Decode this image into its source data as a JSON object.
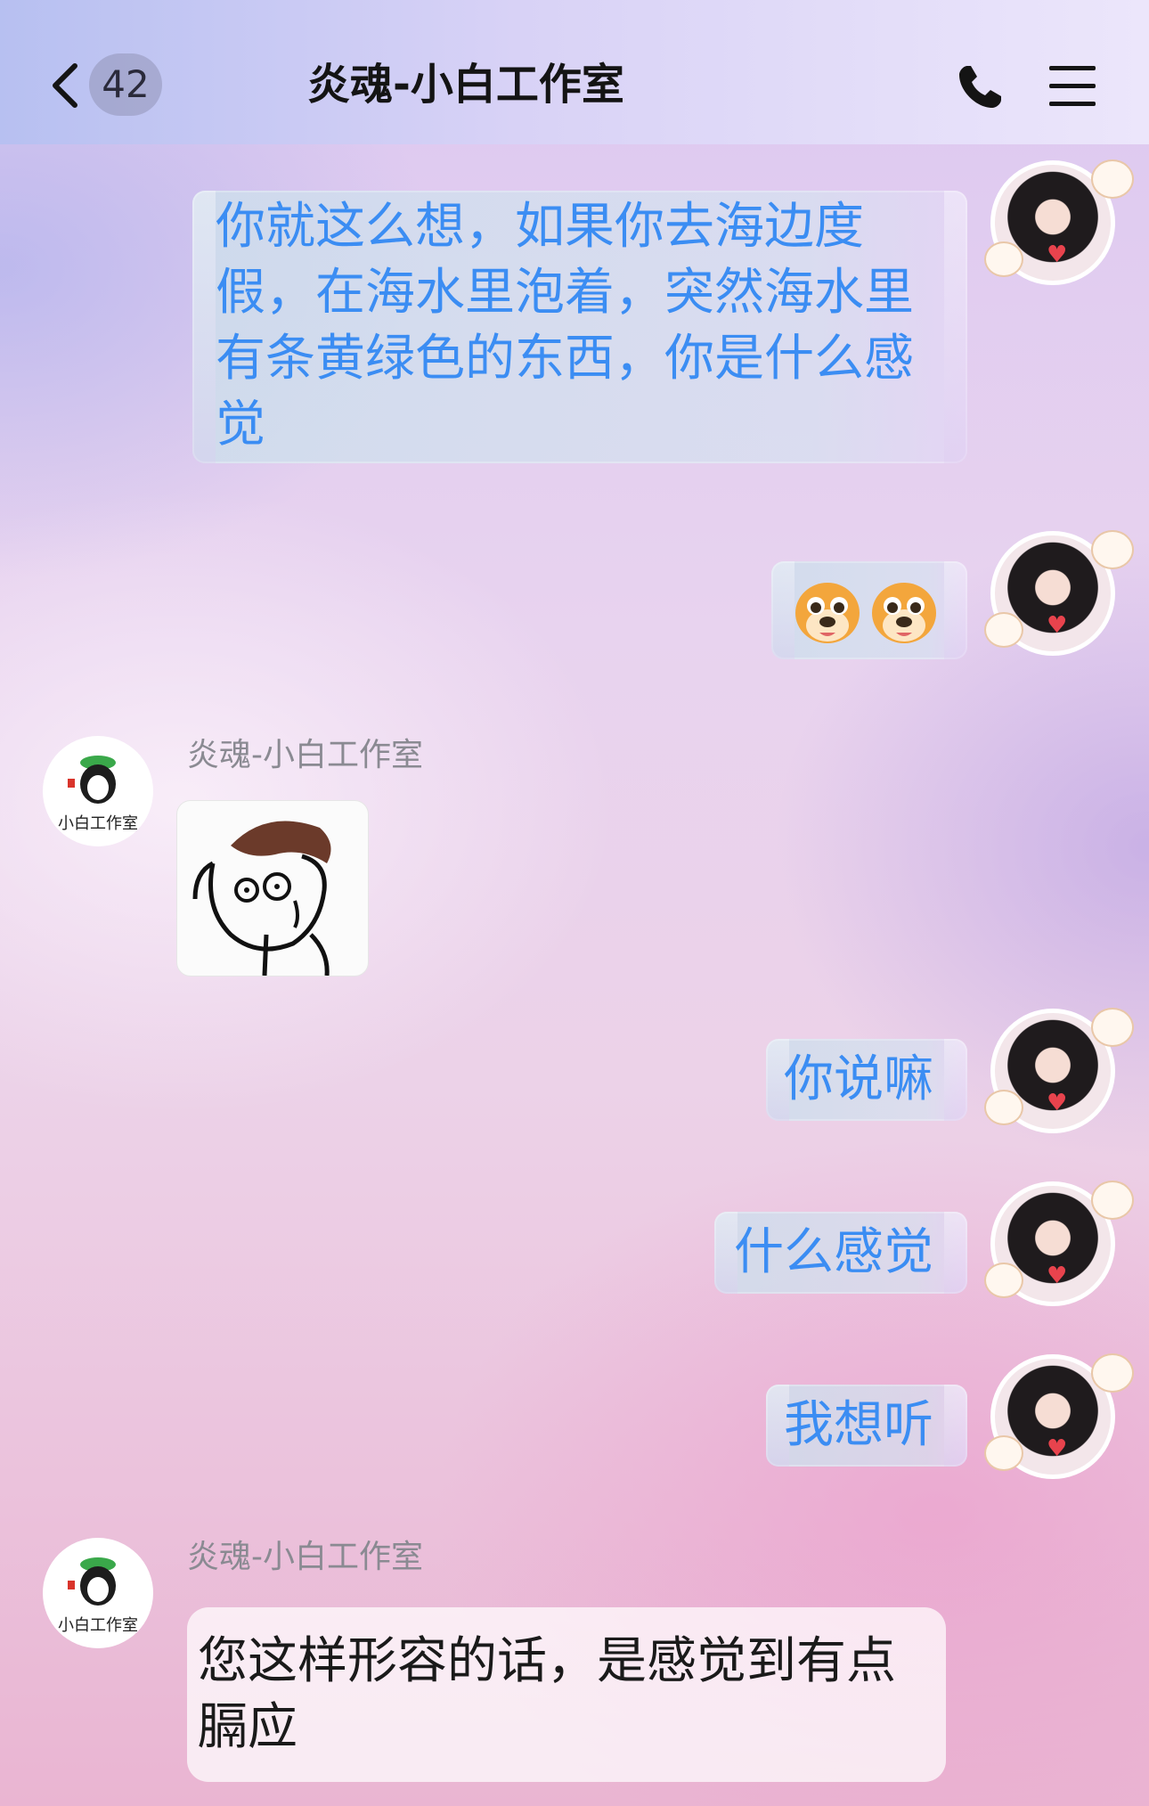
{
  "header": {
    "unread_count": "42",
    "title": "炎魂-小白工作室",
    "icons": [
      "back-icon",
      "phone-icon",
      "menu-icon"
    ]
  },
  "messages": [
    {
      "from": "me",
      "type": "text",
      "text": "你就这么想，如果你去海边度假，在海水里泡着，突然海水里有条黄绿色的东西，你是什么感觉",
      "lines": [
        "你就这么想，如果你去海边度",
        "假，在海水里泡着，突然海水里",
        "有条黄绿色的东西，你是什么感",
        "觉"
      ]
    },
    {
      "from": "me",
      "type": "emoji",
      "emoji": [
        "dog-face-emoji",
        "dog-face-emoji"
      ]
    },
    {
      "from": "other",
      "sender": "炎魂-小白工作室",
      "type": "sticker",
      "sticker": "shocked-face-sticker"
    },
    {
      "from": "me",
      "type": "text",
      "text": "你说嘛"
    },
    {
      "from": "me",
      "type": "text",
      "text": "什么感觉"
    },
    {
      "from": "me",
      "type": "text",
      "text": "我想听"
    },
    {
      "from": "other",
      "sender": "炎魂-小白工作室",
      "type": "text",
      "text": "您这样形容的话，是感觉到有点膈应",
      "lines": [
        "您这样形容的话，是感觉到有点",
        "膈应"
      ]
    }
  ],
  "colors": {
    "my_text": "#3b8df3",
    "other_text": "#1a1a1a",
    "sender_name": "#8a8a92",
    "heart": "#e8434d"
  },
  "avatar_other_label": "小白工作室"
}
